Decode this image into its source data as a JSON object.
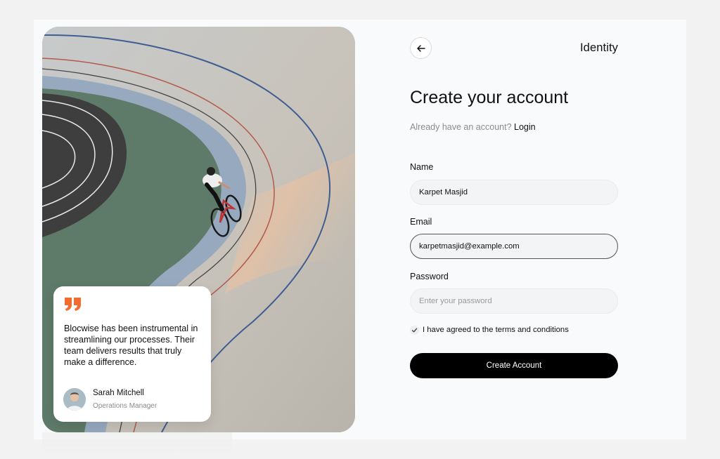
{
  "header": {
    "back_icon": "arrow-left-icon",
    "brand": "Identity"
  },
  "form": {
    "title": "Create your account",
    "subtitle_prefix": "Already have an account?",
    "login_link": "Login",
    "name_label": "Name",
    "name_value": "Karpet Masjid",
    "email_label": "Email",
    "email_value": "karpetmasjid@example.com",
    "password_label": "Password",
    "password_placeholder": "Enter your password",
    "agree_label": "I have agreed to the terms and conditions",
    "agree_checked": true,
    "submit_label": "Create Account"
  },
  "testimonial": {
    "quote_icon": "quote-icon",
    "quote_color": "#f26b2f",
    "text": "Blocwise has been instrumental in streamlining our processes. Their team delivers results that truly make a difference.",
    "author_name": "Sarah Mitchell",
    "author_role": "Operations Manager"
  }
}
